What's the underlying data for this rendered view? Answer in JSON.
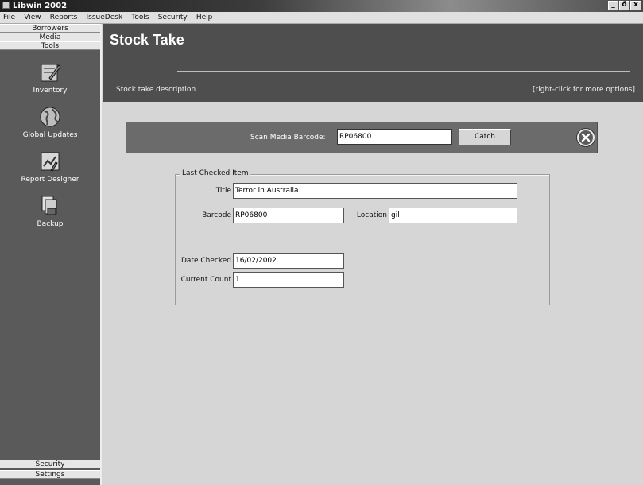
{
  "window": {
    "title": "Libwin 2002",
    "controls": [
      "_",
      "ő",
      "x"
    ]
  },
  "menu": [
    "File",
    "View",
    "Reports",
    "IssueDesk",
    "Tools",
    "Security",
    "Help"
  ],
  "sidebar": {
    "top_tabs": [
      "Borrowers",
      "Media",
      "Tools"
    ],
    "tools": [
      {
        "label": "Inventory",
        "icon": "inventory-icon"
      },
      {
        "label": "Global Updates",
        "icon": "globe-icon"
      },
      {
        "label": "Report Designer",
        "icon": "report-designer-icon"
      },
      {
        "label": "Backup",
        "icon": "backup-icon"
      }
    ],
    "bottom_tabs": [
      "Security",
      "Settings"
    ]
  },
  "header": {
    "title": "Stock Take",
    "description": "Stock take description",
    "hint": "[right-click for more options]"
  },
  "scan": {
    "label": "Scan Media Barcode:",
    "value": "RP06800",
    "button": "Catch"
  },
  "last_item": {
    "legend": "Last Checked Item",
    "title_label": "Title",
    "title_value": "Terror in Australia.",
    "barcode_label": "Barcode",
    "barcode_value": "RP06800",
    "location_label": "Location",
    "location_value": "gil",
    "date_label": "Date Checked",
    "date_value": "16/02/2002",
    "count_label": "Current Count",
    "count_value": "1"
  }
}
